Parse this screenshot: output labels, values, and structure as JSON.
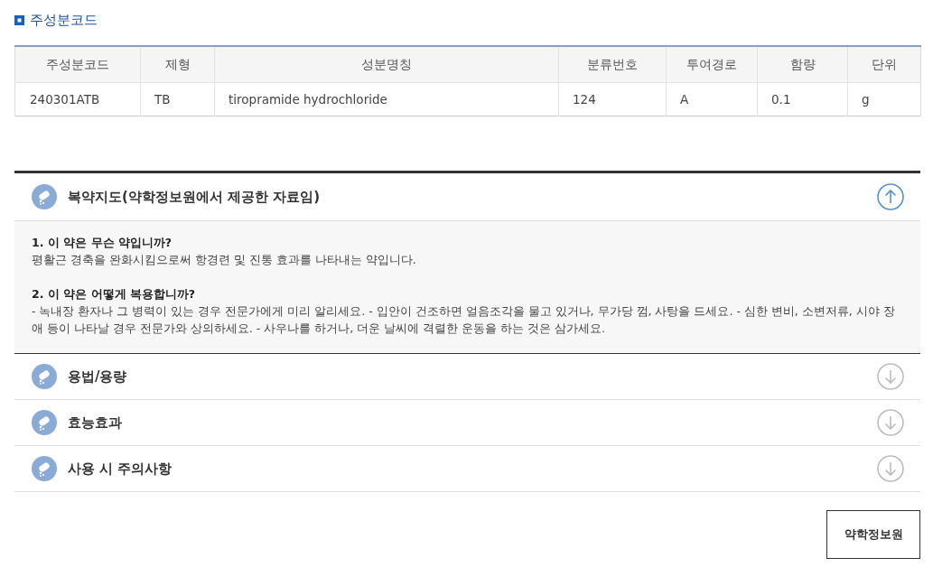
{
  "section_title": "주성분코드",
  "table": {
    "columns": [
      "주성분코드",
      "제형",
      "성분명칭",
      "분류번호",
      "투여경로",
      "함량",
      "단위"
    ],
    "rows": [
      [
        "240301ATB",
        "TB",
        "tiropramide hydrochloride",
        "124",
        "A",
        "0.1",
        "g"
      ]
    ]
  },
  "accordion": [
    {
      "title": "복약지도(약학정보원에서 제공한 자료임)",
      "expanded": true,
      "sections": [
        {
          "question": "1. 이 약은 무슨 약입니까?",
          "answer": "평활근 경축을 완화시킴으로써 항경련 및 진통 효과를 나타내는 약입니다."
        },
        {
          "question": "2. 이 약은 어떻게 복용합니까?",
          "answer": "- 녹내장 환자나 그 병력이 있는 경우 전문가에게 미리 알리세요. - 입안이 건조하면 얼음조각을 물고 있거나, 무가당 껌, 사탕을 드세요. - 심한 변비, 소변저류, 시야 장애 등이 나타날 경우 전문가와 상의하세요. - 사우나를 하거나, 더운 날씨에 격렬한 운동을 하는 것은 삼가세요."
        }
      ]
    },
    {
      "title": "용법/용량",
      "expanded": false
    },
    {
      "title": "효능효과",
      "expanded": false
    },
    {
      "title": "사용 시 주의사항",
      "expanded": false
    }
  ],
  "source_button": "약학정보원"
}
